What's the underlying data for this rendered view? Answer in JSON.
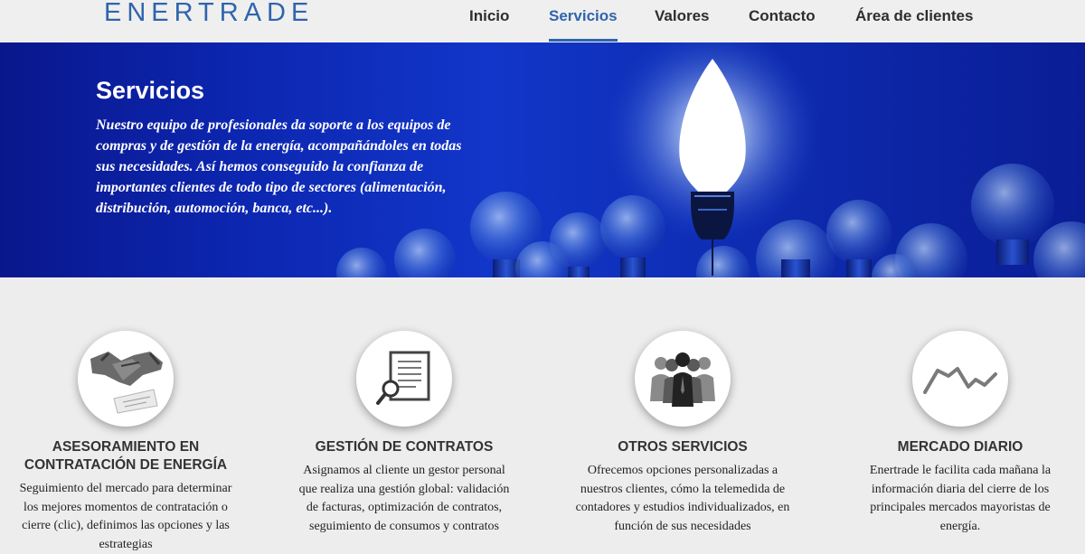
{
  "header": {
    "logo": "ENERTRADE",
    "nav": [
      {
        "label": "Inicio",
        "active": false
      },
      {
        "label": "Servicios",
        "active": true
      },
      {
        "label": "Valores",
        "active": false
      },
      {
        "label": "Contacto",
        "active": false
      },
      {
        "label": "Área de clientes",
        "active": false
      }
    ]
  },
  "hero": {
    "title": "Servicios",
    "text": "Nuestro equipo de profesionales da soporte a los equipos de compras y de gestión de la energía, acompañándoles en todas sus necesidades. Así hemos conseguido la confianza de importantes clientes de todo tipo de sectores (alimentación, distribución, automoción, banca, etc...).",
    "image_icon": "light-bulbs-illustration"
  },
  "services": [
    {
      "icon": "handshake-icon",
      "title": "ASESORAMIENTO EN CONTRATACIÓN DE ENERGÍA",
      "text": "Seguimiento del mercado para determinar los mejores momentos de contratación o cierre (clic), definimos las opciones y las estrategias"
    },
    {
      "icon": "contract-document-icon",
      "title": "GESTIÓN DE CONTRATOS",
      "text": "Asignamos al cliente un gestor personal que realiza una gestión global: validación de facturas, optimización de contratos, seguimiento de consumos y contratos"
    },
    {
      "icon": "people-group-icon",
      "title": "OTROS SERVICIOS",
      "text": "Ofrecemos opciones personalizadas a nuestros clientes, cómo la telemedida de contadores y estudios individualizados, en función de sus necesidades"
    },
    {
      "icon": "line-chart-icon",
      "title": "MERCADO DIARIO",
      "text": "Enertrade le facilita cada mañana la información diaria del cierre de los principales mercados mayoristas de energía."
    }
  ],
  "colors": {
    "brand": "#2f64ad",
    "hero_bg": "#1236c9",
    "page_bg": "#ededed"
  }
}
